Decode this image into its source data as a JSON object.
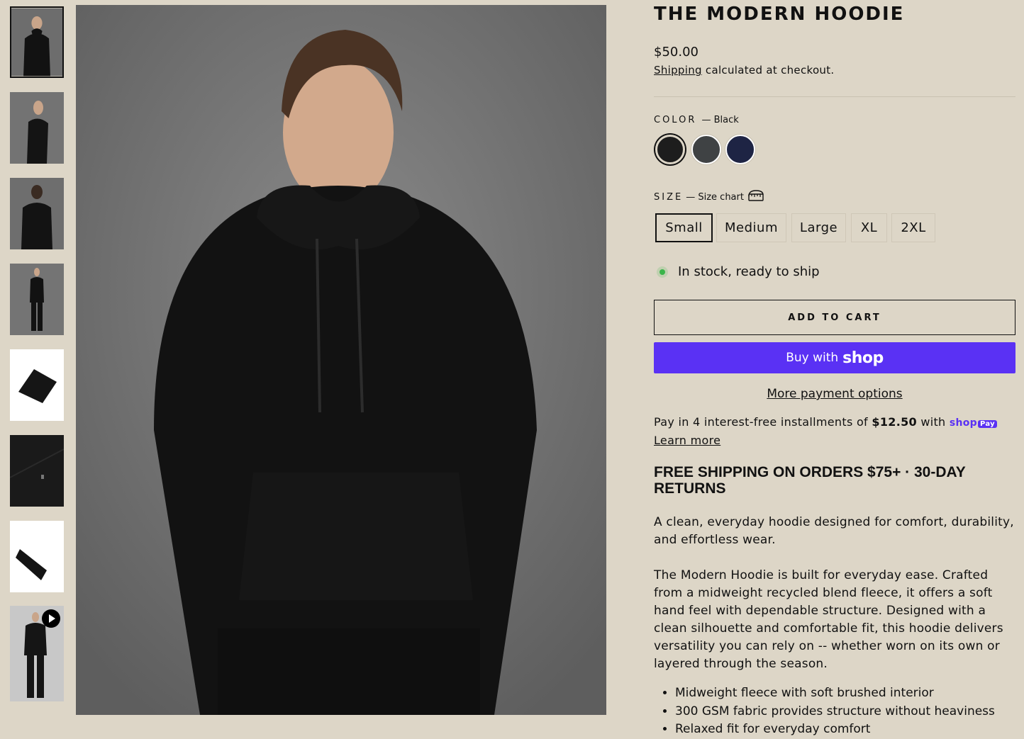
{
  "product": {
    "title": "THE MODERN HOODIE",
    "price": "$50.00",
    "shipping_link": "Shipping",
    "shipping_text": " calculated at checkout."
  },
  "thumbnails": [
    {
      "alt": "front view",
      "kind": "front"
    },
    {
      "alt": "side view",
      "kind": "side"
    },
    {
      "alt": "back view",
      "kind": "back"
    },
    {
      "alt": "full body",
      "kind": "full"
    },
    {
      "alt": "folded",
      "kind": "folded"
    },
    {
      "alt": "fabric detail",
      "kind": "detail"
    },
    {
      "alt": "cuff detail",
      "kind": "cuff"
    },
    {
      "alt": "video",
      "kind": "video"
    }
  ],
  "color": {
    "label": "COLOR",
    "selected_text": "— Black",
    "swatches": [
      {
        "name": "Black",
        "hex": "#1d1d1d"
      },
      {
        "name": "Charcoal",
        "hex": "#3f4244"
      },
      {
        "name": "Navy",
        "hex": "#1e2444"
      }
    ]
  },
  "size": {
    "label": "SIZE",
    "chart_text": "— Size chart",
    "icon": "ruler-icon",
    "options": [
      "Small",
      "Medium",
      "Large",
      "XL",
      "2XL"
    ],
    "selected": "Small"
  },
  "stock": {
    "text": "In stock, ready to ship",
    "color": "#3bb54a"
  },
  "buttons": {
    "add_to_cart": "ADD TO CART",
    "buy_with": "Buy with",
    "shop_logo": "shop",
    "shop_color": "#5a31f4",
    "more_payment": "More payment options"
  },
  "installments": {
    "prefix": "Pay in 4 interest-free installments of ",
    "amount": "$12.50",
    "suffix": " with ",
    "shop_logo": "shop",
    "pay_badge": "Pay",
    "learn_more": "Learn more"
  },
  "promo": "FREE SHIPPING ON ORDERS $75+ · 30-DAY RETURNS",
  "description": {
    "intro": "A clean, everyday hoodie designed for comfort, durability, and effortless wear.",
    "body": "The Modern Hoodie is built for everyday ease. Crafted from a midweight recycled blend fleece, it offers a soft hand feel with dependable structure. Designed with a clean silhouette and comfortable fit, this hoodie delivers versatility you can rely on -- whether worn on its own or layered through the season.",
    "bullets": [
      "Midweight fleece with soft brushed interior",
      "300 GSM fabric provides structure without heaviness",
      "Relaxed fit for everyday comfort"
    ]
  }
}
